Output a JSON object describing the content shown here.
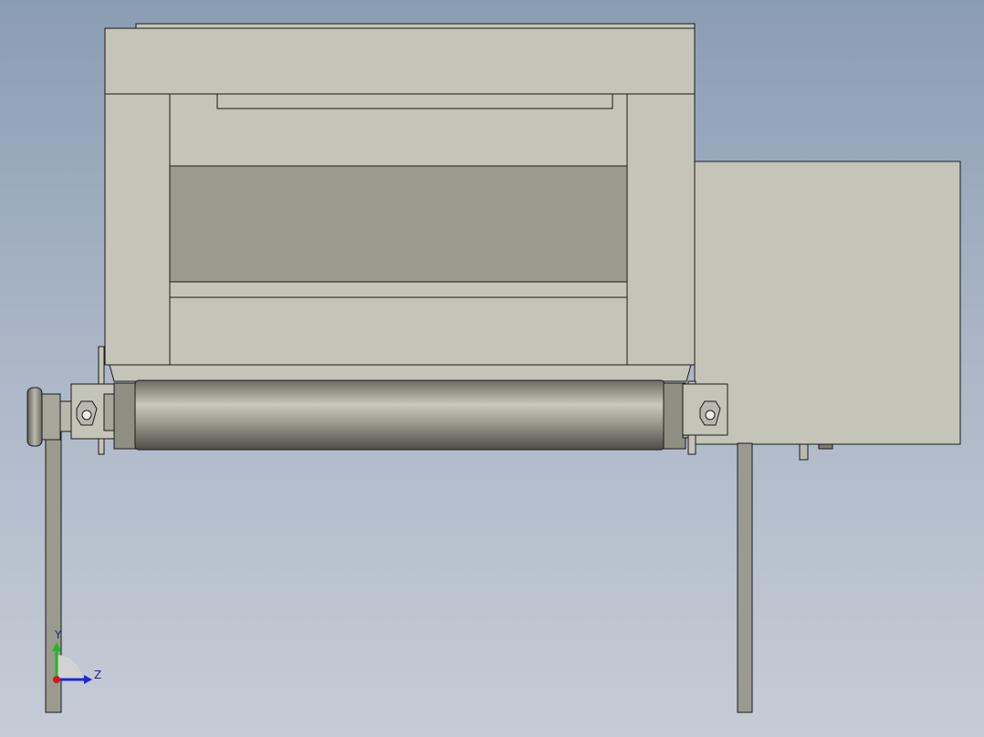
{
  "viewport": {
    "background_top": "#8b9db3",
    "background_bottom": "#c6ccd6"
  },
  "model": {
    "view": "front",
    "body_color": "#c4c4b9",
    "panel_color": "#9a9a8f",
    "roller_color": "#8e8e82",
    "edge_color": "#1a1a1a"
  },
  "triad": {
    "y_label": "Y",
    "z_label": "Z",
    "y_color": "#22b822",
    "z_color": "#1c2ad8",
    "x_color": "#d01818"
  }
}
